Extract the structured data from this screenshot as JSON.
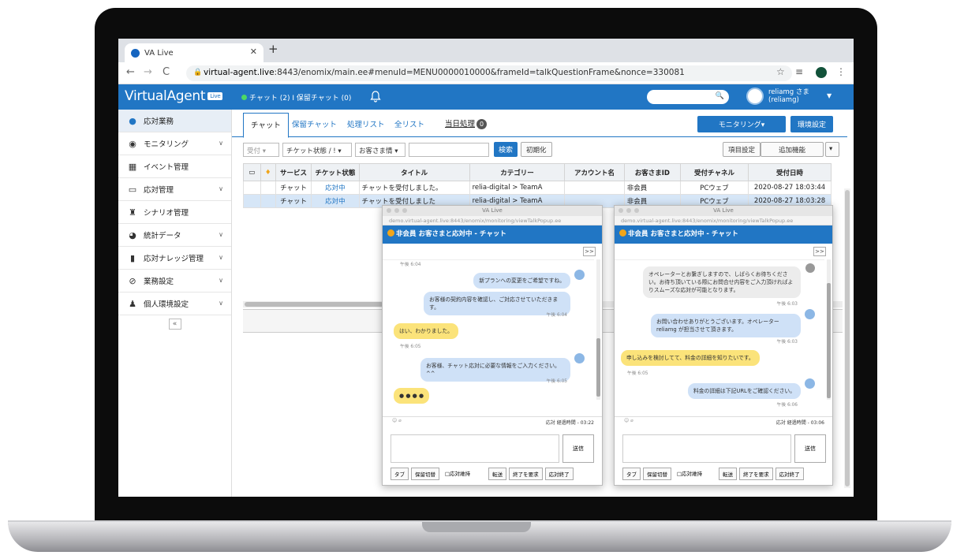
{
  "browser": {
    "tab_title": "VA Live",
    "url_host": "virtual-agent.live",
    "url_rest": ":8443/enomix/main.ee#menuId=MENU0000010000&frameId=talkQuestionFrame&nonce=330081"
  },
  "header": {
    "logo": "VirtualAgent",
    "logo_badge": "Live",
    "status": "チャット (2) I 保留チャット (0)",
    "user_name": "reliamg さま",
    "user_id": "(reliamg)"
  },
  "sidebar": {
    "items": [
      {
        "label": "応対業務",
        "icon": "chat-icon"
      },
      {
        "label": "モニタリング",
        "icon": "eye-icon"
      },
      {
        "label": "イベント管理",
        "icon": "gift-icon"
      },
      {
        "label": "応対管理",
        "icon": "monitor-icon"
      },
      {
        "label": "シナリオ管理",
        "icon": "scenario-icon"
      },
      {
        "label": "統計データ",
        "icon": "pie-chart-icon"
      },
      {
        "label": "応対ナレッジ管理",
        "icon": "book-icon"
      },
      {
        "label": "業務設定",
        "icon": "compass-icon"
      },
      {
        "label": "個人環境設定",
        "icon": "user-icon"
      }
    ],
    "collapse": "«"
  },
  "tabs": {
    "chat": "チャット",
    "hold": "保留チャット",
    "process": "処理リスト",
    "all": "全リスト",
    "today": "当日処理",
    "today_count": "0"
  },
  "actions": {
    "monitoring": "モニタリング▾",
    "env": "環境設定"
  },
  "toolbar": {
    "receive": "受付",
    "ticket_status": "チケット状態 / ! ▾",
    "customer_info": "お客さま情 ▾",
    "search": "検索",
    "reset": "初期化",
    "item_settings": "項目設定",
    "add_func": "追加機能"
  },
  "table": {
    "headers": [
      "サービス",
      "チケット状態",
      "タイトル",
      "カテゴリー",
      "アカウント名",
      "お客さまID",
      "受付チャネル",
      "受付日時"
    ],
    "rows": [
      [
        "チャット",
        "応対中",
        "チャットを受付しました。",
        "relia-digital > TeamA",
        "",
        "非会員",
        "PCウェブ",
        "2020-08-27 18:03:44"
      ],
      [
        "チャット",
        "応対中",
        "チャットを受付しました",
        "relia-digital > TeamA",
        "",
        "非会員",
        "PCウェブ",
        "2020-08-27 18:03:28"
      ]
    ]
  },
  "popup1": {
    "title": "VA Live",
    "url": "demo.virtual-agent.live:8443/enomix/monitoring/viewTalkPopup.ee",
    "header": "非会員 お客さまと応対中 - チャット",
    "expand": ">>",
    "top_time": "午後 6:04",
    "messages": [
      {
        "who": "op",
        "text": "新プランへの変更をご希望ですね。"
      },
      {
        "who": "op",
        "text": "お客様の契約内容を確認し、ご対応させていただきます。",
        "time": "午後 6:04"
      },
      {
        "who": "cu",
        "text": "はい、わかりました。",
        "time": "午後 6:05"
      },
      {
        "who": "op",
        "text": "お客様、チャット応対に必要な情報をご入力ください。 ^^",
        "time": "午後 6:05"
      },
      {
        "who": "cu",
        "text": "● ● ● ●"
      }
    ],
    "elapsed": "応対 経過時間 - 03:22",
    "send": "送信",
    "buttons": [
      "タブ",
      "保留切替",
      "□応対維持",
      "転送",
      "終了を要求",
      "応対終了"
    ]
  },
  "popup2": {
    "title": "VA Live",
    "url": "demo.virtual-agent.live:8443/enomix/monitoring/viewTalkPopup.ee",
    "header": "非会員 お客さまと応対中 - チャット",
    "expand": ">>",
    "messages": [
      {
        "who": "sys",
        "text": "オペレーターとお繋ぎしますので、しばらくお待ちください。お待ち頂いている際にお問合せ内容をご入力頂ければよりスムーズな応対が可能となります。",
        "time": "午後 6:03"
      },
      {
        "who": "op",
        "text": "お問い合わせありがとうございます。オペレーター reliamg が担当させて頂きます。",
        "time": "午後 6:03"
      },
      {
        "who": "cu",
        "text": "申し込みを検討してて、料金の詳細を知りたいです。",
        "time": "午後 6:05"
      },
      {
        "who": "op",
        "text": "料金の詳細は下記URLをご確認ください。",
        "time": "午後 6:06"
      }
    ],
    "elapsed": "応対 経過時間 - 03:06",
    "send": "送信",
    "buttons": [
      "タブ",
      "保留切替",
      "□応対維持",
      "転送",
      "終了を要求",
      "応対終了"
    ]
  }
}
